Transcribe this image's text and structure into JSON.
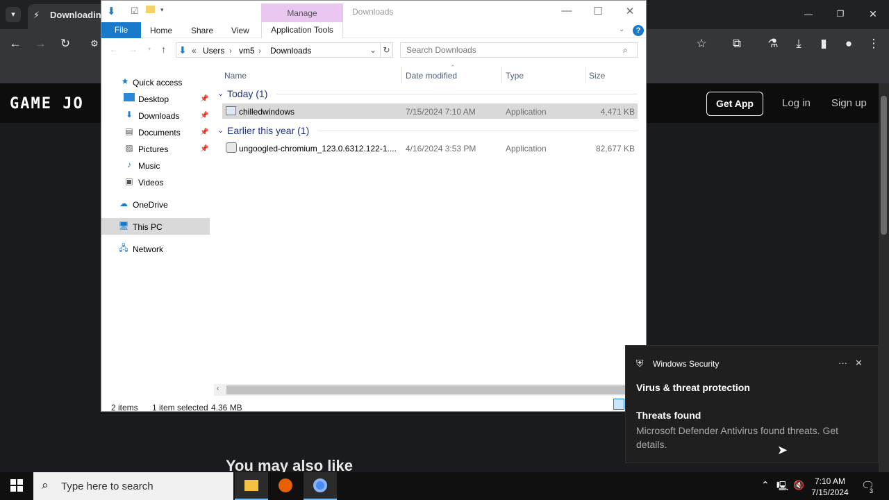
{
  "chrome": {
    "tab_title": "Downloading",
    "site": {
      "logo": "GAME JO",
      "get_app": "Get App",
      "log_in": "Log in",
      "sign_up": "Sign up",
      "also_like": "You may also like"
    }
  },
  "explorer": {
    "title": "Downloads",
    "manage": "Manage",
    "ribbon": {
      "file": "File",
      "home": "Home",
      "share": "Share",
      "view": "View",
      "application_tools": "Application Tools"
    },
    "breadcrumb": [
      "Users",
      "vm5",
      "Downloads"
    ],
    "search_placeholder": "Search Downloads",
    "nav": {
      "quick_access": "Quick access",
      "desktop": "Desktop",
      "downloads": "Downloads",
      "documents": "Documents",
      "pictures": "Pictures",
      "music": "Music",
      "videos": "Videos",
      "onedrive": "OneDrive",
      "this_pc": "This PC",
      "network": "Network"
    },
    "columns": {
      "name": "Name",
      "date_modified": "Date modified",
      "type": "Type",
      "size": "Size"
    },
    "groups": [
      {
        "label": "Today (1)",
        "files": [
          {
            "name": "chilledwindows",
            "date": "7/15/2024 7:10 AM",
            "type": "Application",
            "size": "4,471 KB"
          }
        ]
      },
      {
        "label": "Earlier this year (1)",
        "files": [
          {
            "name": "ungoogled-chromium_123.0.6312.122-1....",
            "date": "4/16/2024 3:53 PM",
            "type": "Application",
            "size": "82,677 KB"
          }
        ]
      }
    ],
    "status": {
      "items": "2 items",
      "selected": "1 item selected",
      "size": "4.36 MB"
    }
  },
  "toast": {
    "app": "Windows Security",
    "title": "Virus & threat protection",
    "subtitle": "Threats found",
    "body": "Microsoft Defender Antivirus found threats. Get details."
  },
  "taskbar": {
    "search_placeholder": "Type here to search",
    "time": "7:10 AM",
    "date": "7/15/2024",
    "notification_count": "3"
  }
}
